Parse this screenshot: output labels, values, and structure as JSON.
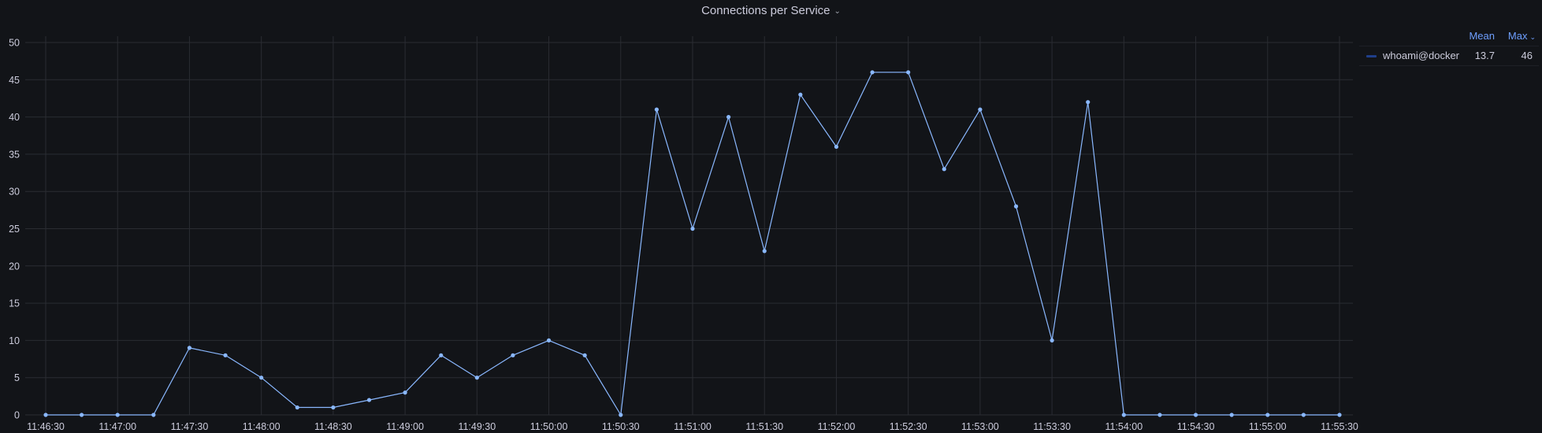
{
  "panel": {
    "title": "Connections per Service",
    "title_menu_icon": "chevron-down-icon"
  },
  "legend": {
    "columns": [
      {
        "label": "Mean"
      },
      {
        "label": "Max",
        "sort_icon": "chevron-down-icon"
      }
    ],
    "series": [
      {
        "name": "whoami@docker",
        "mean": "13.7",
        "max": "46",
        "color": "#1f3f8a"
      }
    ]
  },
  "colors": {
    "line": "#8ab8ff",
    "grid": "#2a2c32",
    "axis_text": "#ccccdc",
    "legend_header": "#6e9fff",
    "background": "#121418"
  },
  "chart_data": {
    "type": "line",
    "title": "Connections per Service",
    "xlabel": "",
    "ylabel": "",
    "ylim": [
      0,
      50
    ],
    "yticks": [
      "0",
      "5",
      "10",
      "15",
      "20",
      "25",
      "30",
      "35",
      "40",
      "45",
      "50"
    ],
    "xticks": [
      "11:46:30",
      "11:47:00",
      "11:47:30",
      "11:48:00",
      "11:48:30",
      "11:49:00",
      "11:49:30",
      "11:50:00",
      "11:50:30",
      "11:51:00",
      "11:51:30",
      "11:52:00",
      "11:52:30",
      "11:53:00",
      "11:53:30",
      "11:54:00",
      "11:54:30",
      "11:55:00",
      "11:55:30"
    ],
    "x": [
      "11:46:30",
      "11:46:45",
      "11:47:00",
      "11:47:15",
      "11:47:30",
      "11:47:45",
      "11:48:00",
      "11:48:15",
      "11:48:30",
      "11:48:45",
      "11:49:00",
      "11:49:15",
      "11:49:30",
      "11:49:45",
      "11:50:00",
      "11:50:15",
      "11:50:30",
      "11:50:45",
      "11:51:00",
      "11:51:15",
      "11:51:30",
      "11:51:45",
      "11:52:00",
      "11:52:15",
      "11:52:30",
      "11:52:45",
      "11:53:00",
      "11:53:15",
      "11:53:30",
      "11:53:45",
      "11:54:00",
      "11:54:15",
      "11:54:30",
      "11:54:45",
      "11:55:00",
      "11:55:15",
      "11:55:30"
    ],
    "series": [
      {
        "name": "whoami@docker",
        "values": [
          0,
          0,
          0,
          0,
          9,
          8,
          5,
          1,
          1,
          2,
          3,
          8,
          5,
          8,
          10,
          8,
          0,
          41,
          25,
          40,
          22,
          43,
          36,
          46,
          46,
          33,
          41,
          28,
          10,
          42,
          0,
          0,
          0,
          0,
          0,
          0,
          0
        ]
      }
    ],
    "grid": true,
    "legend_position": "right"
  }
}
